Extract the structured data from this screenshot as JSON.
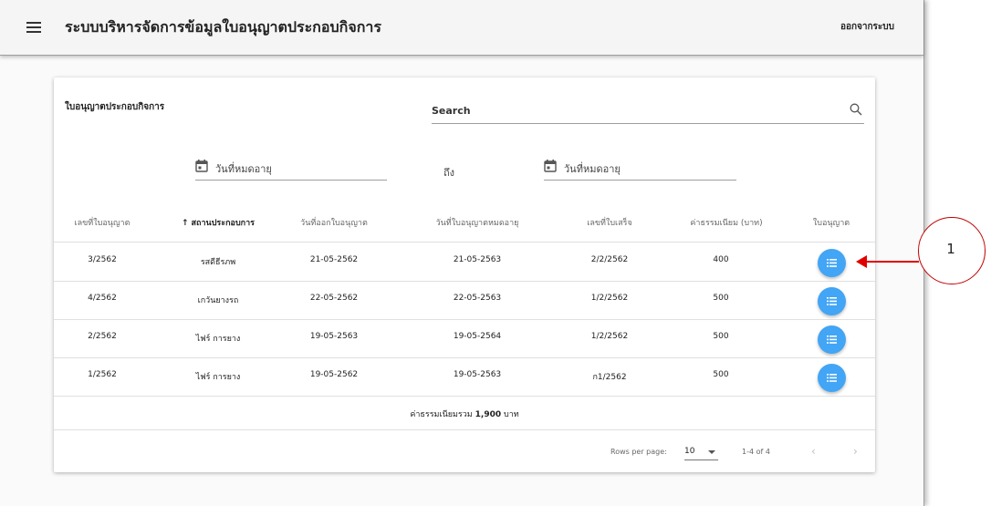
{
  "header": {
    "title": "ระบบบริหารจัดการข้อมูลใบอนุญาตประกอบกิจการ",
    "logout_label": "ออกจากระบบ"
  },
  "card": {
    "title": "ใบอนุญาตประกอบกิจการ",
    "search_placeholder": "Search",
    "date_from_label": "วันที่หมดอายุ",
    "to_label": "ถึง",
    "date_to_label": "วันที่หมดอายุ"
  },
  "table": {
    "columns": [
      "เลขที่ใบอนุญาต",
      "สถานประกอบการ",
      "วันที่ออกใบอนุญาต",
      "วันที่ใบอนุญาตหมดอายุ",
      "เลขที่ใบเสร็จ",
      "ค่าธรรมเนียม (บาท)",
      "ใบอนุญาต"
    ],
    "sorted_column_arrow": "↑",
    "rows": [
      [
        "3/2562",
        "รสดีธีรภพ",
        "21-05-2562",
        "21-05-2563",
        "2/2/2562",
        "400"
      ],
      [
        "4/2562",
        "เกวันยางรถ",
        "22-05-2562",
        "22-05-2563",
        "1/2/2562",
        "500"
      ],
      [
        "2/2562",
        "ไฟร์ การยาง",
        "19-05-2563",
        "19-05-2564",
        "1/2/2562",
        "500"
      ],
      [
        "1/2562",
        "ไฟร์ การยาง",
        "19-05-2562",
        "19-05-2563",
        "ก1/2562",
        "500"
      ]
    ],
    "total_prefix": "ค่าธรรมเนียมรวม",
    "total_value": "1,900",
    "total_suffix": "บาท"
  },
  "pagination": {
    "rows_per_page_label": "Rows per page:",
    "rows_per_page_value": "10",
    "range": "1-4 of 4",
    "prev_glyph": "‹",
    "next_glyph": "›"
  },
  "annotation": {
    "number": "1"
  },
  "colors": {
    "action_button": "#42a5f5",
    "callout": "#e00000"
  },
  "icons": [
    "menu-icon",
    "search-icon",
    "calendar-icon",
    "list-icon",
    "sort-arrow-icon"
  ]
}
